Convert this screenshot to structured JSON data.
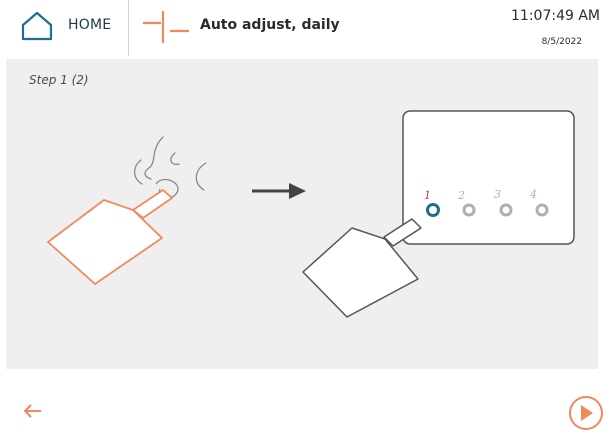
{
  "header": {
    "home_label": "HOME",
    "title": "Auto adjust, daily",
    "time": "11:07:49 AM",
    "date": "8/5/2022"
  },
  "content": {
    "step_label": "Step 1 (2)",
    "positions": [
      {
        "label": "1",
        "active": true
      },
      {
        "label": "2",
        "active": false
      },
      {
        "label": "3",
        "active": false
      },
      {
        "label": "4",
        "active": false
      }
    ]
  },
  "colors": {
    "accent_orange": "#f08a5d",
    "accent_blue": "#1e6e8c",
    "home_icon": "#1e6e8c",
    "panel_bg": "#efefef",
    "inactive_dot": "#b0b0b0"
  },
  "icons": {
    "home": "home-icon",
    "mode": "adjust-mode-icon",
    "back": "arrow-left-icon",
    "next": "play-icon"
  }
}
